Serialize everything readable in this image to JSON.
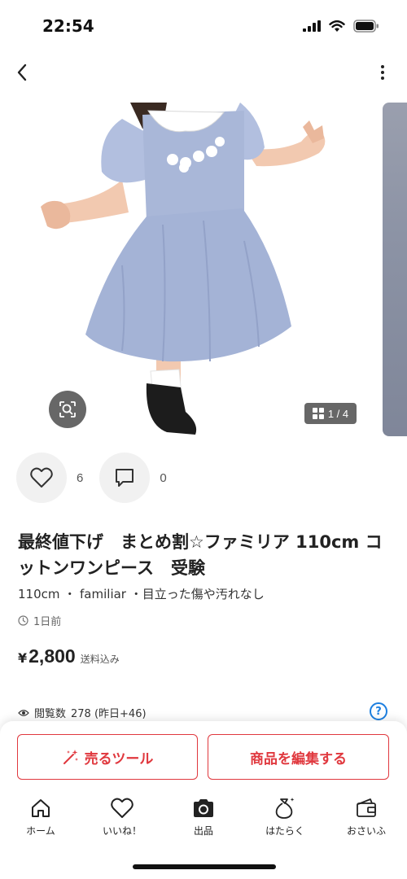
{
  "status": {
    "time": "22:54"
  },
  "gallery": {
    "page_indicator": "1 / 4"
  },
  "reactions": {
    "likes": "6",
    "comments": "0"
  },
  "item": {
    "title": "最終値下げ　まとめ割☆ファミリア 110cm コットンワンピース　受験",
    "details": "110cm ・ familiar ・目立った傷や汚れなし",
    "posted": "1日前",
    "price_symbol": "¥",
    "price": "2,800",
    "price_note": "送料込み"
  },
  "stats": {
    "views_label": "閲覧数",
    "views_value": "278 (昨日+46)",
    "help": "?"
  },
  "actions": {
    "sell_tool": "売るツール",
    "edit_item": "商品を編集する"
  },
  "tabbar": {
    "items": [
      {
        "label": "ホーム",
        "icon": "home-icon"
      },
      {
        "label": "いいね！",
        "icon": "heart-icon"
      },
      {
        "label": "出品",
        "icon": "camera-icon"
      },
      {
        "label": "はたらく",
        "icon": "money-bag-icon"
      },
      {
        "label": "おさいふ",
        "icon": "wallet-icon"
      }
    ]
  },
  "colors": {
    "accent": "#e0383e",
    "help_blue": "#1d7fe0",
    "dress_blue": "#a9b7d8"
  }
}
